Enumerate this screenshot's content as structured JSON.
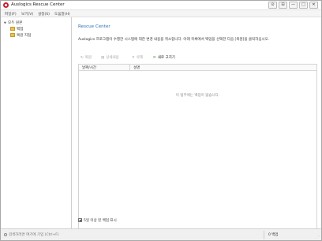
{
  "window": {
    "title": "Auslogics Rescue Center",
    "controls": {
      "button_1": "⊙",
      "button_2": "⊟",
      "minimize": "—",
      "maximize": "□",
      "close": "✕"
    }
  },
  "menu": {
    "items": [
      "파일(F)",
      "보기(V)",
      "설정(S)",
      "도움말(H)"
    ]
  },
  "sidebar": {
    "root": {
      "toggle": "▼",
      "label": "모두 원본"
    },
    "children": [
      {
        "label": "백업"
      },
      {
        "label": "복원 지점"
      }
    ]
  },
  "main": {
    "heading": "Rescue Center",
    "description": "Auslogics 프로그램이 수행한 시스템에 대한 변경 내용을 취소합니다. 아래 목록에서 백업을 선택한 다음 [복원]을 클릭하십시오.",
    "toolbar": {
      "restore": {
        "icon": "↻",
        "label": "복원"
      },
      "view_details": {
        "icon": "▤",
        "label": "상세내용"
      },
      "delete": {
        "icon": "✕",
        "label": "삭제"
      },
      "refresh": {
        "icon": "⟳",
        "label": "새로 고치기"
      }
    },
    "table": {
      "columns": [
        "날짜/시간",
        "설명"
      ],
      "empty_message": "이 범주에는 백업이 없습니다."
    },
    "show_old_backups": {
      "label": "5일 이상 된 백업 표시",
      "checked": true
    }
  },
  "statusbar": {
    "search_placeholder": "검색하려면 여기에 기입 (Ctrl+F)",
    "count": "0 백업"
  },
  "colors": {
    "accent": "#2f6fb7",
    "brand": "#c8202b",
    "folder": "#e8c250",
    "refresh": "#3e9a3e"
  }
}
